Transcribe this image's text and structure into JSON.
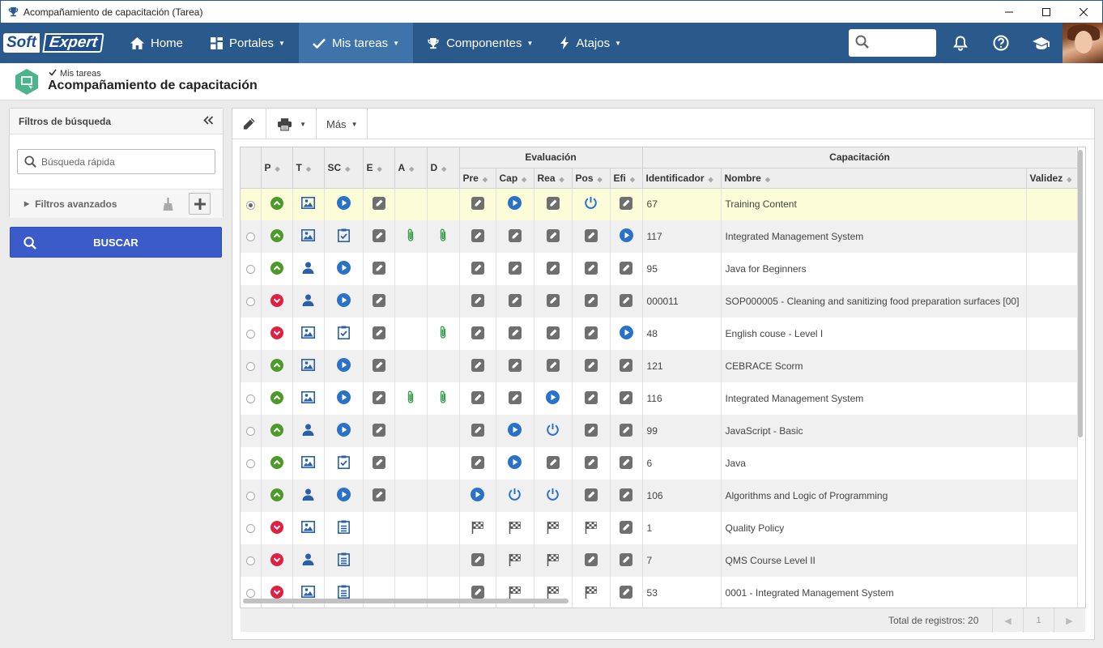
{
  "window": {
    "title": "Acompañamiento de capacitación (Tarea)"
  },
  "nav": {
    "logo_soft": "Soft",
    "logo_expert": "Expert",
    "items": [
      {
        "label": "Home",
        "icon": "home-icon",
        "dropdown": false
      },
      {
        "label": "Portales",
        "icon": "grid-icon",
        "dropdown": true
      },
      {
        "label": "Mis tareas",
        "icon": "check-icon",
        "dropdown": true,
        "active": true
      },
      {
        "label": "Componentes",
        "icon": "trophy-icon",
        "dropdown": true
      },
      {
        "label": "Atajos",
        "icon": "bolt-icon",
        "dropdown": true
      }
    ],
    "search_placeholder": ""
  },
  "page": {
    "breadcrumb": "Mis tareas",
    "title": "Acompañamiento de capacitación"
  },
  "filters": {
    "title": "Filtros de búsqueda",
    "quick_search_placeholder": "Búsqueda rápida",
    "advanced_label": "Filtros avanzados",
    "search_button": "BUSCAR"
  },
  "toolbar": {
    "more_label": "Más"
  },
  "grid": {
    "group_headers": {
      "evaluacion": "Evaluación",
      "capacitacion": "Capacitación"
    },
    "columns": [
      "P",
      "T",
      "SC",
      "E",
      "A",
      "D",
      "Pre",
      "Cap",
      "Rea",
      "Pos",
      "Efi",
      "Identificador",
      "Nombre",
      "Validez"
    ],
    "rows": [
      {
        "p": "up",
        "t": "pic",
        "sc": "play",
        "e": "edit",
        "a": "",
        "d": "",
        "pre": "edit",
        "cap": "play",
        "rea": "edit",
        "pos": "power",
        "efi": "edit",
        "id": "67",
        "name": "Training Content",
        "selected": true
      },
      {
        "p": "up",
        "t": "pic",
        "sc": "check",
        "e": "edit",
        "a": "clip",
        "d": "clip",
        "pre": "edit",
        "cap": "edit",
        "rea": "edit",
        "pos": "edit",
        "efi": "play",
        "id": "117",
        "name": "Integrated Management System"
      },
      {
        "p": "up",
        "t": "user",
        "sc": "play",
        "e": "edit",
        "a": "",
        "d": "",
        "pre": "edit",
        "cap": "edit",
        "rea": "edit",
        "pos": "edit",
        "efi": "edit",
        "id": "95",
        "name": "Java for Beginners"
      },
      {
        "p": "down",
        "t": "user",
        "sc": "play",
        "e": "edit",
        "a": "",
        "d": "",
        "pre": "edit",
        "cap": "edit",
        "rea": "edit",
        "pos": "edit",
        "efi": "edit",
        "id": "000011",
        "name": "SOP000005 - Cleaning and sanitizing food preparation surfaces [00]"
      },
      {
        "p": "down",
        "t": "pic",
        "sc": "check",
        "e": "edit",
        "a": "",
        "d": "clip",
        "pre": "edit",
        "cap": "edit",
        "rea": "edit",
        "pos": "edit",
        "efi": "play",
        "id": "48",
        "name": "English couse - Level I"
      },
      {
        "p": "up",
        "t": "pic",
        "sc": "play",
        "e": "edit",
        "a": "",
        "d": "",
        "pre": "edit",
        "cap": "edit",
        "rea": "edit",
        "pos": "edit",
        "efi": "edit",
        "id": "121",
        "name": "CEBRACE Scorm"
      },
      {
        "p": "up",
        "t": "pic",
        "sc": "play",
        "e": "edit",
        "a": "clip",
        "d": "clip",
        "pre": "edit",
        "cap": "edit",
        "rea": "play",
        "pos": "edit",
        "efi": "edit",
        "id": "116",
        "name": "Integrated Management System"
      },
      {
        "p": "up",
        "t": "user",
        "sc": "play",
        "e": "edit",
        "a": "",
        "d": "",
        "pre": "edit",
        "cap": "play",
        "rea": "power",
        "pos": "edit",
        "efi": "edit",
        "id": "99",
        "name": "JavaScript - Basic"
      },
      {
        "p": "up",
        "t": "pic",
        "sc": "check",
        "e": "edit",
        "a": "",
        "d": "",
        "pre": "edit",
        "cap": "play",
        "rea": "edit",
        "pos": "edit",
        "efi": "edit",
        "id": "6",
        "name": "Java"
      },
      {
        "p": "up",
        "t": "user",
        "sc": "play",
        "e": "edit",
        "a": "",
        "d": "",
        "pre": "play",
        "cap": "power",
        "rea": "power",
        "pos": "edit",
        "efi": "edit",
        "id": "106",
        "name": "Algorithms and Logic of Programming"
      },
      {
        "p": "down",
        "t": "pic",
        "sc": "list",
        "e": "",
        "a": "",
        "d": "",
        "pre": "flag",
        "cap": "flag",
        "rea": "flag",
        "pos": "flag",
        "efi": "edit",
        "id": "1",
        "name": "Quality Policy"
      },
      {
        "p": "down",
        "t": "user",
        "sc": "list",
        "e": "",
        "a": "",
        "d": "",
        "pre": "edit",
        "cap": "flag",
        "rea": "flag",
        "pos": "edit",
        "efi": "edit",
        "id": "7",
        "name": "QMS Course Level II"
      },
      {
        "p": "down",
        "t": "pic",
        "sc": "list",
        "e": "",
        "a": "",
        "d": "",
        "pre": "edit",
        "cap": "flag",
        "rea": "flag",
        "pos": "flag",
        "efi": "edit",
        "id": "53",
        "name": "0001 - Integrated Management System"
      }
    ]
  },
  "footer": {
    "total": "Total de registros: 20",
    "page": "1"
  },
  "colors": {
    "nav_bg": "#2a5a8c",
    "nav_active": "#3e74aa",
    "buscar": "#3a5bc8",
    "green": "#4c9a2a",
    "red": "#e02040",
    "blue": "#2a72c8",
    "selected_row": "#fdfcd8"
  }
}
